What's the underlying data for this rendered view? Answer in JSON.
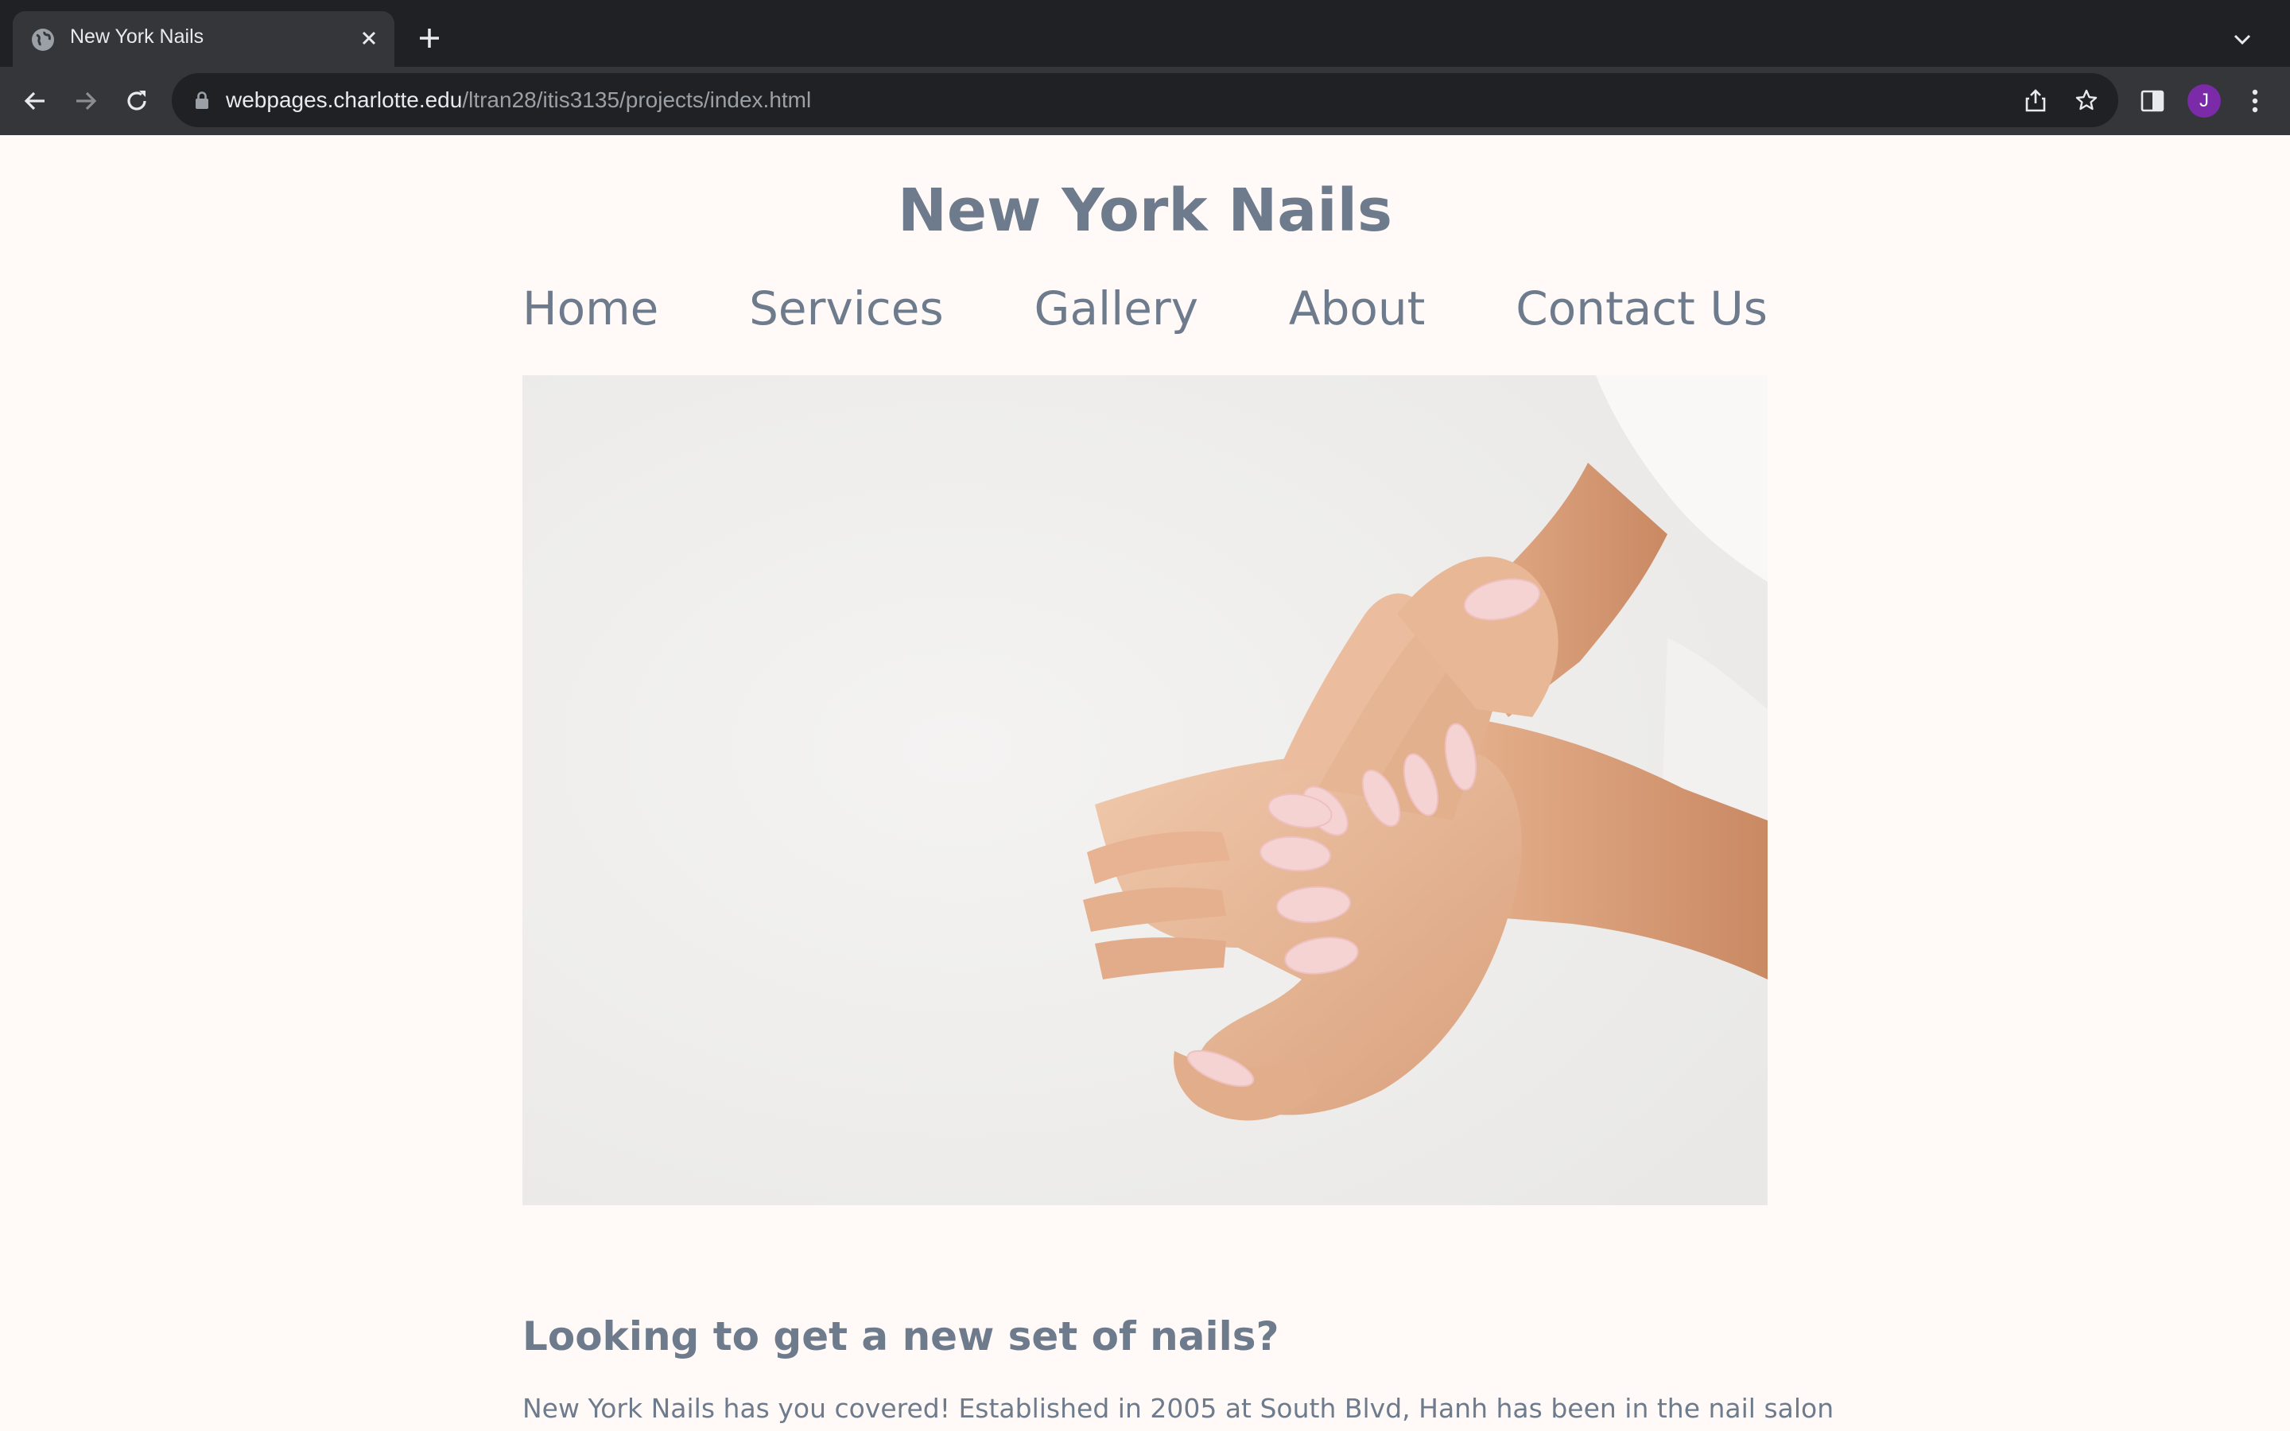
{
  "browser": {
    "tab": {
      "title": "New York Nails"
    },
    "address": {
      "host": "webpages.charlotte.edu",
      "path": "/ltran28/itis3135/projects/index.html"
    },
    "profile_initial": "J"
  },
  "site": {
    "title": "New York Nails",
    "nav": [
      "Home",
      "Services",
      "Gallery",
      "About",
      "Contact Us"
    ],
    "hero_image": "hands-manicure-photo",
    "heading": "Looking to get a new set of nails?",
    "paragraph": "New York Nails has you covered! Established in 2005 at South Blvd, Hanh has been in the nail salon"
  },
  "colors": {
    "text": "#6e7b8c",
    "page_bg": "#fffaf8",
    "chrome_dark": "#202124",
    "chrome_toolbar": "#35363a",
    "avatar": "#7b2aa8"
  }
}
